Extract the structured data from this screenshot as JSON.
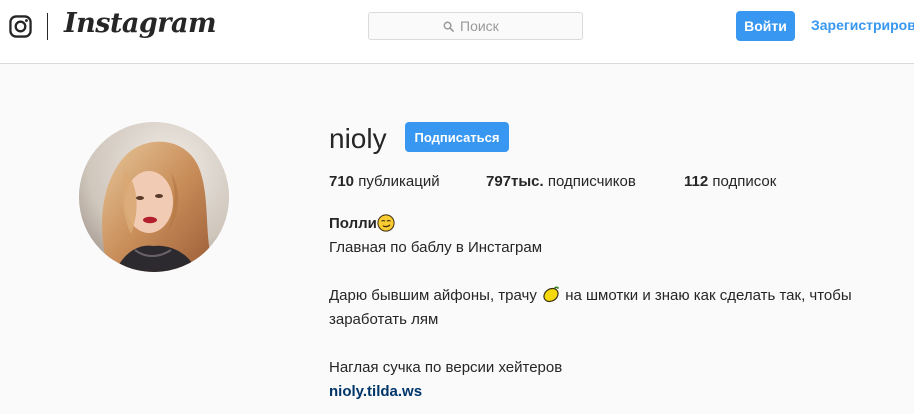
{
  "header": {
    "logo_icon": "instagram-glyph-icon",
    "wordmark": "Instagram",
    "search": {
      "placeholder": "Поиск",
      "value": "",
      "icon": "search-icon"
    },
    "login_label": "Войти",
    "signup_label": "Зарегистрироваться"
  },
  "profile": {
    "avatar_icon": "profile-photo",
    "username": "nioly",
    "follow_label": "Подписаться",
    "stats": {
      "posts_count": "710",
      "posts_label": "публикаций",
      "followers_count": "797тыс.",
      "followers_label": "подписчиков",
      "following_count": "112",
      "following_label": "подписок"
    },
    "bio": {
      "name": "Полли",
      "name_emoji": "smirking-face-emoji",
      "line1": "Главная по баблу в Инстаграм",
      "line2_part1": "Дарю бывшим айфоны, трачу",
      "line2_emoji": "lemon-emoji",
      "line2_part2": "на шмотки и знаю как сделать так, чтобы",
      "line3": "заработать лям",
      "line4": "Наглая сучка по версии хейтеров",
      "link": "nioly.tilda.ws"
    }
  },
  "colors": {
    "accent": "#3897f0",
    "link": "#003569",
    "text": "#262626",
    "background": "#fafafa",
    "border": "#dbdbdb"
  }
}
